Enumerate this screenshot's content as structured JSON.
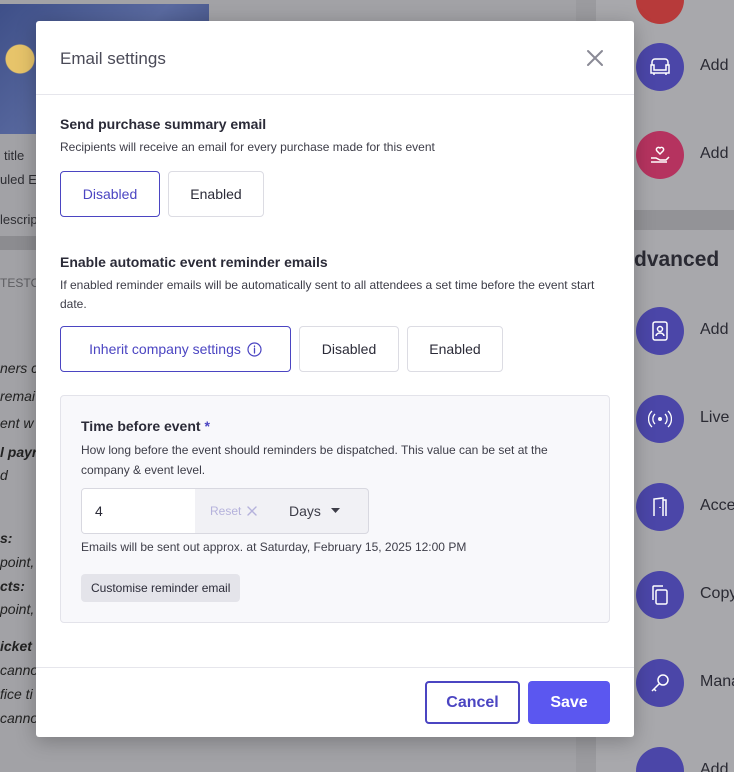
{
  "background": {
    "left_labels": [
      "title",
      "uled Ev",
      "lescrip",
      "TESTCO"
    ],
    "left_italic": [
      "ners c",
      "remai",
      "ent w",
      "l payr",
      "d",
      "s:",
      "point,",
      "cts:",
      "point,",
      "icket",
      "canno",
      "fice ti",
      "canno"
    ],
    "section_heading": "dvanced",
    "right_items": [
      "Add",
      "Add",
      "Add",
      "Live",
      "Acce",
      "Copy",
      "Mana",
      "Add"
    ]
  },
  "modal": {
    "title": "Email settings",
    "purchase_summary": {
      "title": "Send purchase summary email",
      "description": "Recipients will receive an email for every purchase made for this event",
      "options": [
        "Disabled",
        "Enabled"
      ],
      "selected": "Disabled"
    },
    "reminder": {
      "title": "Enable automatic event reminder emails",
      "description": "If enabled reminder emails will be automatically sent to all attendees a set time before the event start date.",
      "options": [
        "Inherit company settings",
        "Disabled",
        "Enabled"
      ],
      "selected": "Inherit company settings"
    },
    "time_before": {
      "title": "Time before event",
      "required_mark": "*",
      "description": "How long before the event should reminders be dispatched. This value can be set at the company & event level.",
      "value": "4",
      "reset_label": "Reset",
      "unit": "Days",
      "note": "Emails will be sent out approx. at Saturday, February 15, 2025 12:00 PM",
      "customise_label": "Customise reminder email"
    },
    "footer": {
      "cancel_label": "Cancel",
      "save_label": "Save"
    }
  },
  "colors": {
    "accent": "#4b45c2",
    "primary_button": "#5b57f0"
  }
}
